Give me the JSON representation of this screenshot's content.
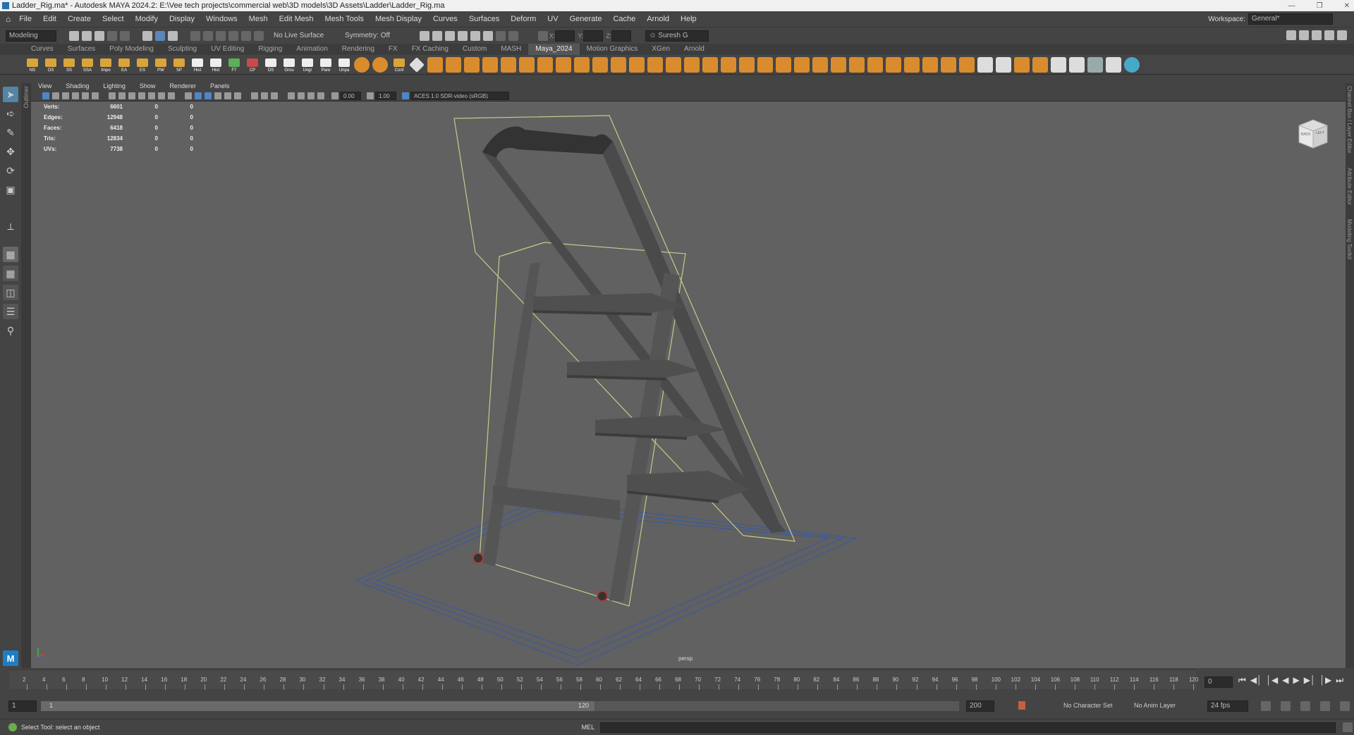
{
  "window": {
    "title": "Ladder_Rig.ma* - Autodesk MAYA 2024.2: E:\\Vee tech projects\\commercial web\\3D models\\3D Assets\\Ladder\\Ladder_Rig.ma"
  },
  "menu": [
    "File",
    "Edit",
    "Create",
    "Select",
    "Modify",
    "Display",
    "Windows",
    "Mesh",
    "Edit Mesh",
    "Mesh Tools",
    "Mesh Display",
    "Curves",
    "Surfaces",
    "Deform",
    "UV",
    "Generate",
    "Cache",
    "Arnold",
    "Help"
  ],
  "workspace": {
    "label": "Workspace:",
    "value": "General*"
  },
  "statusline": {
    "mode": "Modeling",
    "live_surface": "No Live Surface",
    "symmetry": "Symmetry: Off",
    "x_label": "X:",
    "y_label": "Y:",
    "z_label": "Z:",
    "user": "Suresh G"
  },
  "shelf_tabs": [
    "Curves",
    "Surfaces",
    "Poly Modeling",
    "Sculpting",
    "UV Editing",
    "Rigging",
    "Animation",
    "Rendering",
    "FX",
    "FX Caching",
    "Custom",
    "MASH",
    "Maya_2024",
    "Motion Graphics",
    "XGen",
    "Arnold"
  ],
  "shelf_active": "Maya_2024",
  "shelf_buttons": [
    "NS",
    "OS",
    "SS",
    "SSA",
    "Impo",
    "EA",
    "ES",
    "PW",
    "SP",
    "Hist",
    "Hist",
    "FT",
    "CP",
    "DS",
    "Grou",
    "Ungr",
    "Pare",
    "Unpa",
    "Conf"
  ],
  "panel_menu": [
    "View",
    "Shading",
    "Lighting",
    "Show",
    "Renderer",
    "Panels"
  ],
  "panel_tools": {
    "exposure": "0.00",
    "gamma": "1.00",
    "color_space": "ACES 1.0 SDR-video (sRGB)"
  },
  "outliner_tab": "Outliner",
  "hud": [
    {
      "label": "Verts:",
      "value": "6601",
      "a": "0",
      "b": "0"
    },
    {
      "label": "Edges:",
      "value": "12948",
      "a": "0",
      "b": "0"
    },
    {
      "label": "Faces:",
      "value": "6418",
      "a": "0",
      "b": "0"
    },
    {
      "label": "Tris:",
      "value": "12834",
      "a": "0",
      "b": "0"
    },
    {
      "label": "UVs:",
      "value": "7738",
      "a": "0",
      "b": "0"
    }
  ],
  "camera": "persp",
  "viewcube": {
    "face1": "BACK",
    "face2": "LEFT"
  },
  "right_tabs": [
    "Channel Box / Layer Editor",
    "Attribute Editor",
    "Modeling Toolkit"
  ],
  "timeline": {
    "ticks": [
      "2",
      "4",
      "6",
      "8",
      "10",
      "12",
      "14",
      "16",
      "18",
      "20",
      "22",
      "24",
      "26",
      "28",
      "30",
      "32",
      "34",
      "36",
      "38",
      "40",
      "42",
      "44",
      "46",
      "48",
      "50",
      "52",
      "54",
      "56",
      "58",
      "60",
      "62",
      "64",
      "66",
      "68",
      "70",
      "72",
      "74",
      "76",
      "78",
      "80",
      "82",
      "84",
      "86",
      "88",
      "90",
      "92",
      "94",
      "96",
      "98",
      "100",
      "102",
      "104",
      "106",
      "108",
      "110",
      "112",
      "114",
      "116",
      "118",
      "120"
    ],
    "current_frame": "0"
  },
  "range": {
    "start": "1",
    "inner_start": "1",
    "inner_end": "120",
    "end": "200",
    "character_set": "No Character Set",
    "anim_layer": "No Anim Layer",
    "fps": "24 fps"
  },
  "cmdline": {
    "help": "Select Tool: select an object",
    "lang": "MEL"
  },
  "colors": {
    "viewport_bg": "#616161",
    "ui_bg": "#444444",
    "accent_blue": "#5285a6",
    "shelf_orange": "#d98c2e",
    "selection_yellow": "#c8c98a"
  }
}
